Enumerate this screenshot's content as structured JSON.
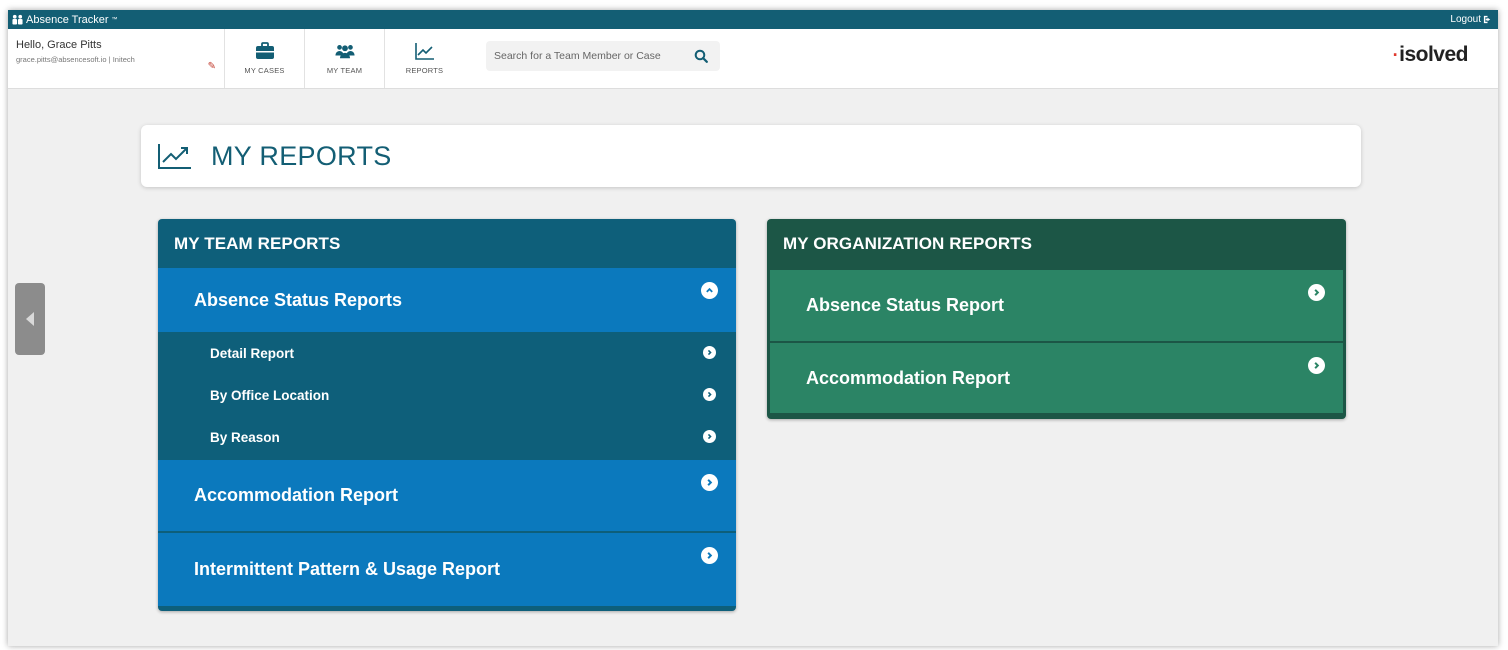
{
  "app": {
    "name": "Absence Tracker",
    "trademark": "™",
    "logout_label": "Logout"
  },
  "user": {
    "greeting": "Hello, Grace Pitts",
    "email_line": "grace.pitts@absencesoft.io | Initech"
  },
  "nav": [
    {
      "label": "MY CASES",
      "icon": "briefcase-icon"
    },
    {
      "label": "MY TEAM",
      "icon": "team-icon"
    },
    {
      "label": "REPORTS",
      "icon": "chart-line-icon"
    }
  ],
  "search": {
    "placeholder": "Search for a Team Member or Case"
  },
  "logo": {
    "text": "isolved"
  },
  "page": {
    "title": "MY REPORTS"
  },
  "team_reports": {
    "heading": "MY TEAM REPORTS",
    "absence_status": {
      "label": "Absence Status Reports",
      "items": [
        "Detail Report",
        "By Office Location",
        "By Reason"
      ]
    },
    "accommodation": "Accommodation Report",
    "intermittent": "Intermittent Pattern & Usage Report"
  },
  "org_reports": {
    "heading": "MY ORGANIZATION REPORTS",
    "items": [
      "Absence Status Report",
      "Accommodation Report"
    ]
  },
  "colors": {
    "topbar": "#135e74",
    "team_panel": "#0e5f7a",
    "team_row": "#0b79bd",
    "org_panel": "#1c5646",
    "org_row": "#2b8465",
    "accent_red": "#e03a2f"
  }
}
